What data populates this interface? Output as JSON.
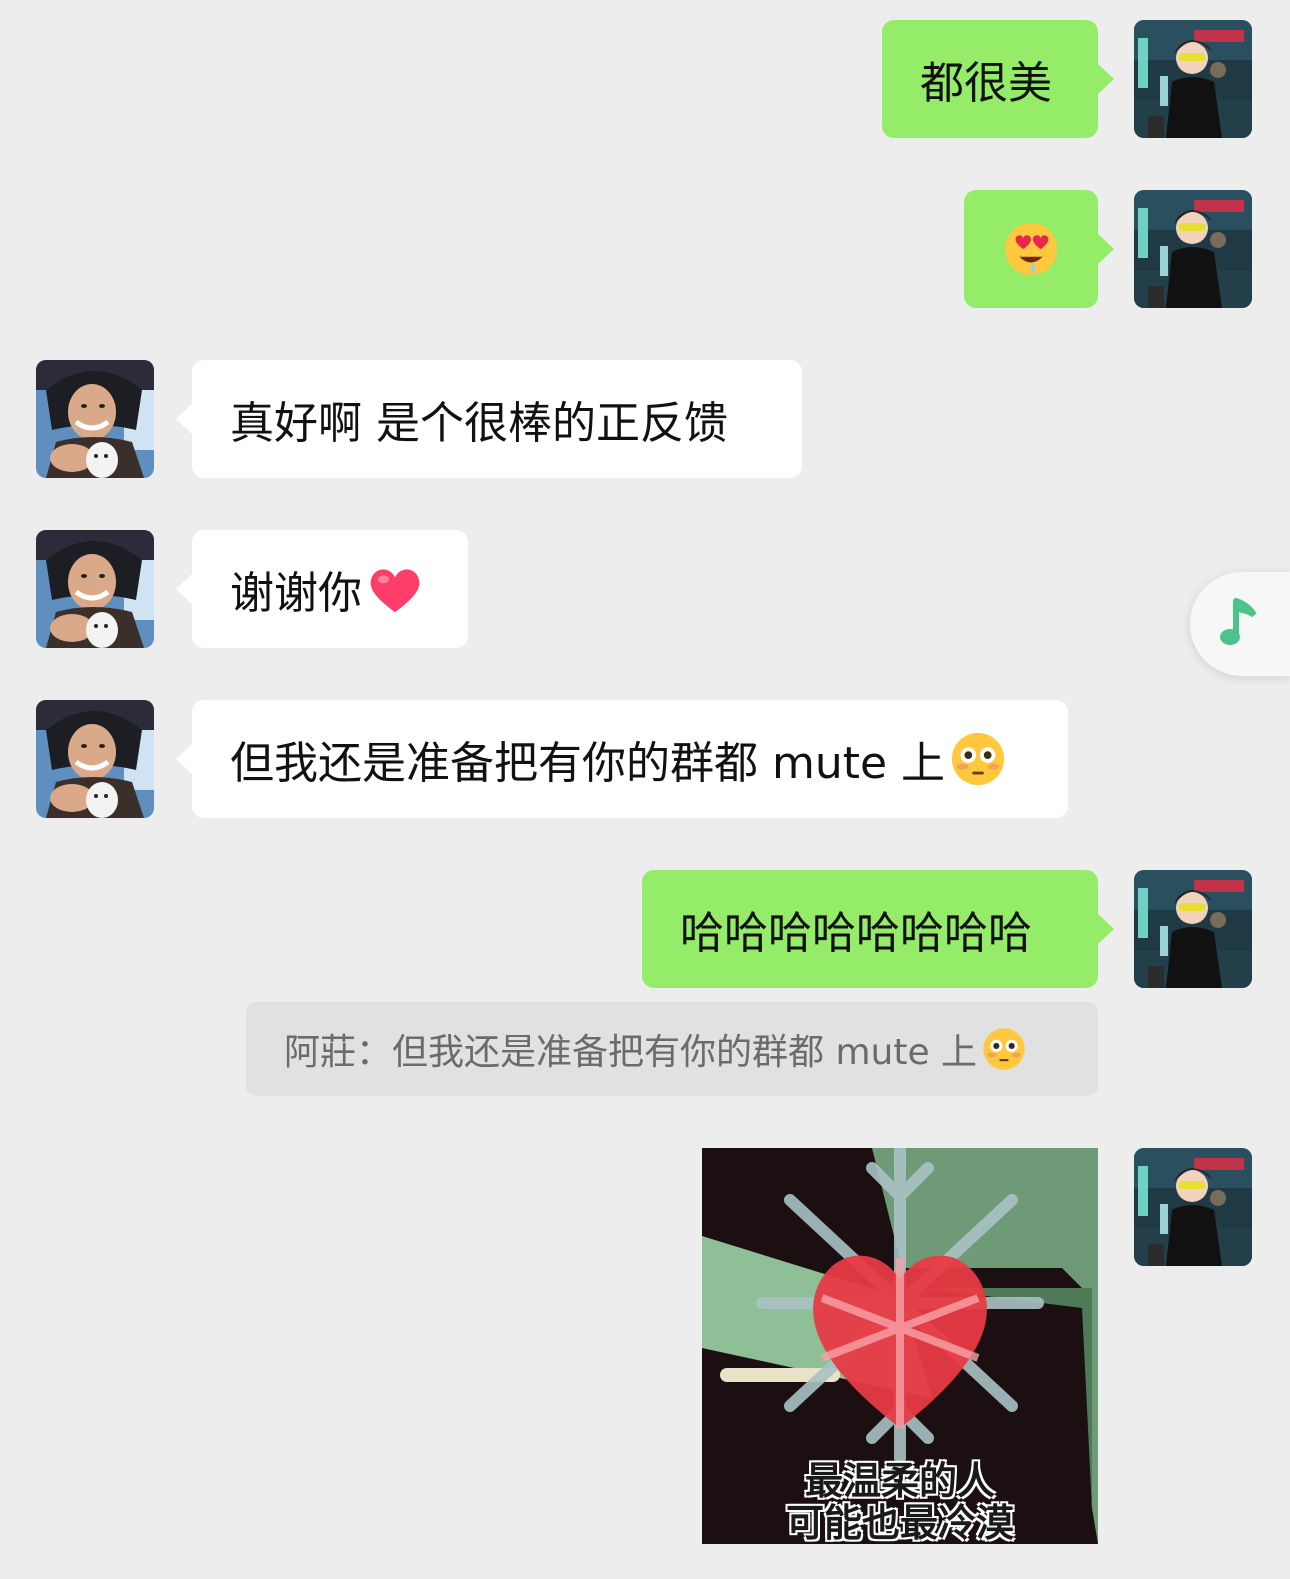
{
  "messages": [
    {
      "side": "me",
      "text": "都很美"
    },
    {
      "side": "me",
      "emoji": "heart-eyes-drool-emoji"
    },
    {
      "side": "them",
      "text": "真好啊 是个很棒的正反馈"
    },
    {
      "side": "them",
      "text": "谢谢你",
      "emoji": "red-heart-emoji"
    },
    {
      "side": "them",
      "text": "但我还是准备把有你的群都 mute 上",
      "emoji": "flushed-face-emoji"
    },
    {
      "side": "me",
      "text": "哈哈哈哈哈哈哈哈"
    },
    {
      "side": "me",
      "sticker": "snowflake-heart-sticker",
      "caption_line1": "最温柔的人",
      "caption_line2": "可能也最冷漠"
    }
  ],
  "quote": {
    "text": "阿莊：但我还是准备把有你的群都 mute 上",
    "emoji": "flushed-face-emoji"
  },
  "floating": {
    "icon": "music-note-icon",
    "accent": "#4cc38a"
  },
  "colors": {
    "me_bubble": "#95ec69",
    "them_bubble": "#ffffff",
    "background": "#ededed"
  }
}
